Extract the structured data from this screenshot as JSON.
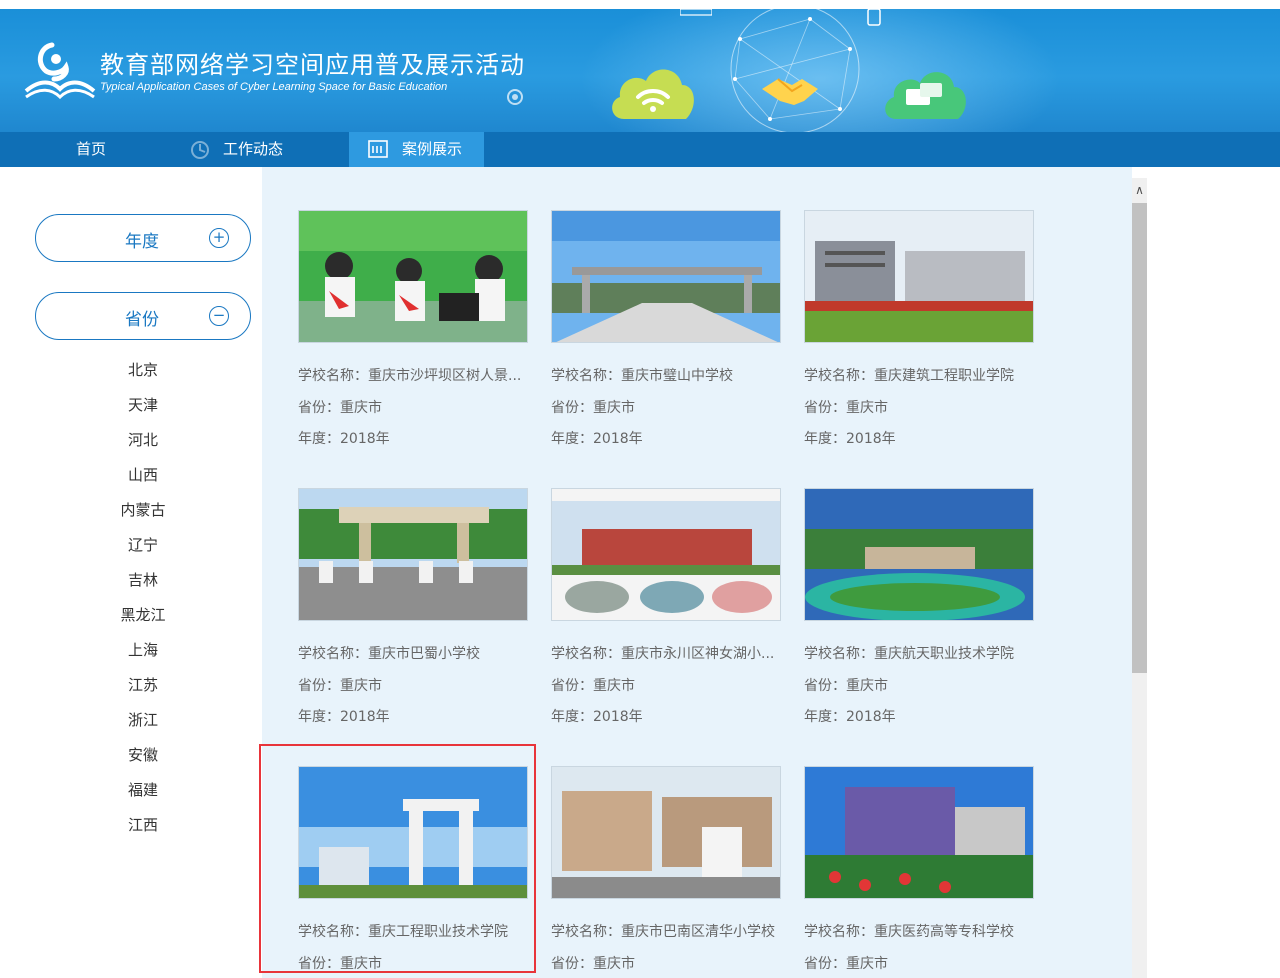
{
  "header": {
    "title_cn": "教育部网络学习空间应用普及展示活动",
    "title_en": "Typical Application Cases of Cyber Learning Space for Basic Education",
    "logo": "book-swan-logo",
    "decorations": [
      "wifi-cloud-icon",
      "handshake-globe-icon",
      "chat-cloud-icon"
    ]
  },
  "nav": {
    "items": [
      {
        "label": "首页",
        "icon": ""
      },
      {
        "label": "工作动态",
        "icon": "news-icon"
      },
      {
        "label": "案例展示",
        "icon": "case-board-icon"
      }
    ],
    "active": "案例展示"
  },
  "sidebar": {
    "filters": [
      {
        "label": "年度",
        "toggle": "+",
        "state": "collapsed"
      },
      {
        "label": "省份",
        "toggle": "−",
        "state": "expanded"
      }
    ],
    "provinces": [
      "北京",
      "天津",
      "河北",
      "山西",
      "内蒙古",
      "辽宁",
      "吉林",
      "黑龙江",
      "上海",
      "江苏",
      "浙江",
      "安徽",
      "福建",
      "江西"
    ]
  },
  "cards": [
    {
      "school": "学校名称：重庆市沙坪坝区树人景...",
      "province": "省份：重庆市",
      "year": "年度：2018年"
    },
    {
      "school": "学校名称：重庆市璧山中学校",
      "province": "省份：重庆市",
      "year": "年度：2018年"
    },
    {
      "school": "学校名称：重庆建筑工程职业学院",
      "province": "省份：重庆市",
      "year": "年度：2018年"
    },
    {
      "school": "学校名称：重庆市巴蜀小学校",
      "province": "省份：重庆市",
      "year": "年度：2018年"
    },
    {
      "school": "学校名称：重庆市永川区神女湖小...",
      "province": "省份：重庆市",
      "year": "年度：2018年"
    },
    {
      "school": "学校名称：重庆航天职业技术学院",
      "province": "省份：重庆市",
      "year": "年度：2018年"
    },
    {
      "school": "学校名称：重庆工程职业技术学院",
      "province": "省份：重庆市",
      "year": ""
    },
    {
      "school": "学校名称：重庆市巴南区清华小学校",
      "province": "省份：重庆市",
      "year": ""
    },
    {
      "school": "学校名称：重庆医药高等专科学校",
      "province": "省份：重庆市",
      "year": ""
    }
  ],
  "colors": {
    "banner": "#1a8fd8",
    "nav": "#0f6fb6",
    "nav_active": "#2e9ae0",
    "accent": "#1a78c2",
    "content_bg": "#e8f3fb",
    "highlight": "#e8343a"
  }
}
